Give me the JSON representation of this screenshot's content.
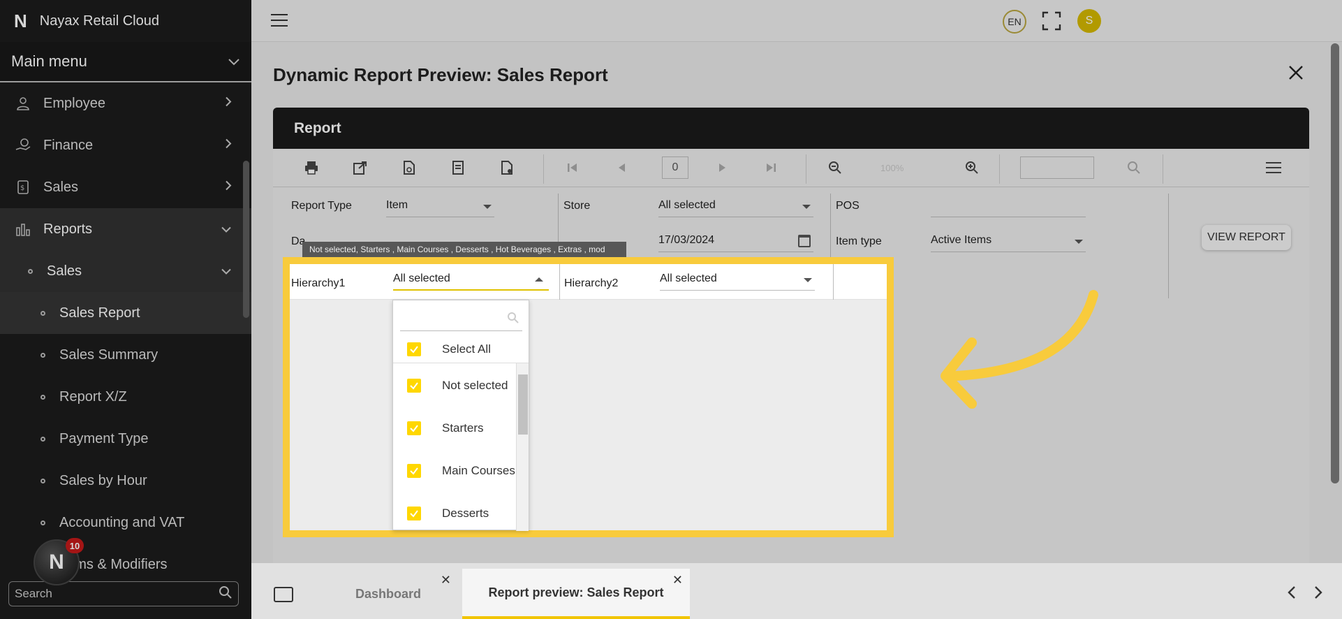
{
  "app": {
    "title": "Nayax Retail Cloud",
    "logo": "N"
  },
  "sidebar": {
    "main_menu": "Main menu",
    "items": [
      {
        "label": "Employee",
        "icon": "employee-icon"
      },
      {
        "label": "Finance",
        "icon": "finance-icon"
      },
      {
        "label": "Sales",
        "icon": "sales-icon"
      },
      {
        "label": "Reports",
        "icon": "reports-icon"
      }
    ],
    "sub_items": [
      {
        "label": "Sales"
      }
    ],
    "subsub_items": [
      {
        "label": "Sales Report"
      },
      {
        "label": "Sales Summary"
      },
      {
        "label": "Report X/Z"
      },
      {
        "label": "Payment Type"
      },
      {
        "label": "Sales by Hour"
      },
      {
        "label": "Accounting and VAT"
      },
      {
        "label": "Items & Modifiers"
      }
    ],
    "search_placeholder": "Search",
    "fab_badge": "10"
  },
  "topbar": {
    "lang": "EN",
    "avatar": "S"
  },
  "page": {
    "title": "Dynamic Report Preview: Sales Report"
  },
  "report": {
    "header": "Report",
    "toolbar": {
      "page_number": "0",
      "zoom": "100%"
    },
    "params": {
      "report_type_label": "Report Type",
      "report_type_value": "Item",
      "store_label": "Store",
      "store_value": "All selected",
      "pos_label": "POS",
      "date_label": "Da",
      "date_to": "17/03/2024",
      "item_type_label": "Item type",
      "item_type_value": "Active Items",
      "hierarchy1_label": "Hierarchy1",
      "hierarchy1_value": "All selected",
      "hierarchy2_label": "Hierarchy2",
      "hierarchy2_value": "All selected",
      "view_report": "VIEW REPORT"
    },
    "tooltip": "Not selected, Starters , Main Courses , Desserts , Hot Beverages , Extras , mod",
    "dropdown": {
      "select_all": "Select All",
      "options": [
        "Not selected",
        "Starters",
        "Main Courses",
        "Desserts"
      ]
    }
  },
  "tabs": [
    {
      "label": "Dashboard"
    },
    {
      "label": "Report preview: Sales Report"
    }
  ],
  "colors": {
    "highlight": "#f8cb3c",
    "accent": "#ffd700",
    "sidebar": "#1c1c1c"
  }
}
